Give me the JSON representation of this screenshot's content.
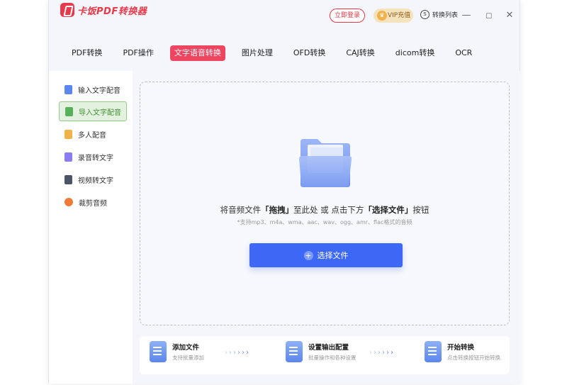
{
  "app": {
    "name": "卡饭PDF转换器"
  },
  "header": {
    "login_label": "立即登录",
    "vip_label": "VIP充值",
    "convert_list_label": "转换列表",
    "minimize": "—",
    "restore": "◻",
    "close": "✕"
  },
  "tabs": [
    {
      "label": "PDF转换"
    },
    {
      "label": "PDF操作"
    },
    {
      "label": "文字语音转换",
      "active": true
    },
    {
      "label": "图片处理"
    },
    {
      "label": "OFD转换"
    },
    {
      "label": "CAJ转换"
    },
    {
      "label": "dicom转换"
    },
    {
      "label": "OCR"
    }
  ],
  "sidebar": {
    "items": [
      {
        "label": "输入文字配音",
        "icon": "text-to-speech-icon",
        "color": "#5b86ef"
      },
      {
        "label": "导入文字配音",
        "icon": "import-text-icon",
        "color": "#58b05a",
        "active": true
      },
      {
        "label": "多人配音",
        "icon": "multi-person-icon",
        "color": "#f1b24a"
      },
      {
        "label": "录音转文字",
        "icon": "audio-to-text-icon",
        "color": "#8a7cf0"
      },
      {
        "label": "视频转文字",
        "icon": "video-to-text-icon",
        "color": "#4a5568"
      },
      {
        "label": "裁剪音频",
        "icon": "audio-cut-icon",
        "color": "#f07a3a"
      }
    ]
  },
  "dropzone": {
    "text_pre": "将音频文件",
    "text_drag": "「拖拽」",
    "text_mid": "至此处 或 点击下方",
    "text_select": "「选择文件」",
    "text_post": "按钮",
    "hint": "*支持mp3、m4a、wma、aac、wav、ogg、amr、flac格式的音频",
    "button_label": "选择文件"
  },
  "steps": [
    {
      "title": "添加文件",
      "subtitle": "支持批量添加"
    },
    {
      "title": "设置输出配置",
      "subtitle": "批量操作和各种设置"
    },
    {
      "title": "开始转换",
      "subtitle": "点击转换按钮开始转换"
    }
  ],
  "colors": {
    "brand_red": "#e8394a",
    "tab_active": "#ee4661",
    "primary_blue": "#3d68f5",
    "sidebar_active_bg": "#e3f1df"
  }
}
